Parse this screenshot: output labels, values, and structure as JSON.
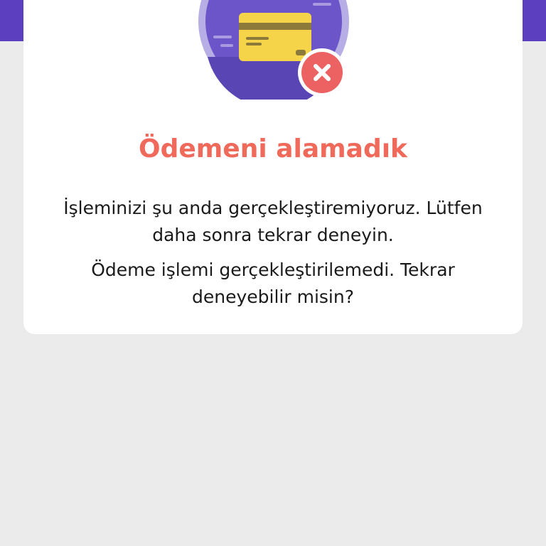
{
  "dialog": {
    "title": "Ödemeni alamadık",
    "message_primary": "İşleminizi şu anda gerçekleştiremiyoruz. Lütfen daha sonra tekrar deneyin.",
    "message_secondary": "Ödeme işlemi gerçekleştirilemedi. Tekrar deneyebilir misin?"
  },
  "illustration": {
    "icons": [
      "credit-card-icon",
      "error-x-icon"
    ]
  },
  "colors": {
    "header": "#5b3fbf",
    "title": "#ef6a5b",
    "background": "#ebebeb",
    "card": "#ffffff",
    "error_badge": "#ec6262",
    "card_yellow": "#f6d44a"
  }
}
